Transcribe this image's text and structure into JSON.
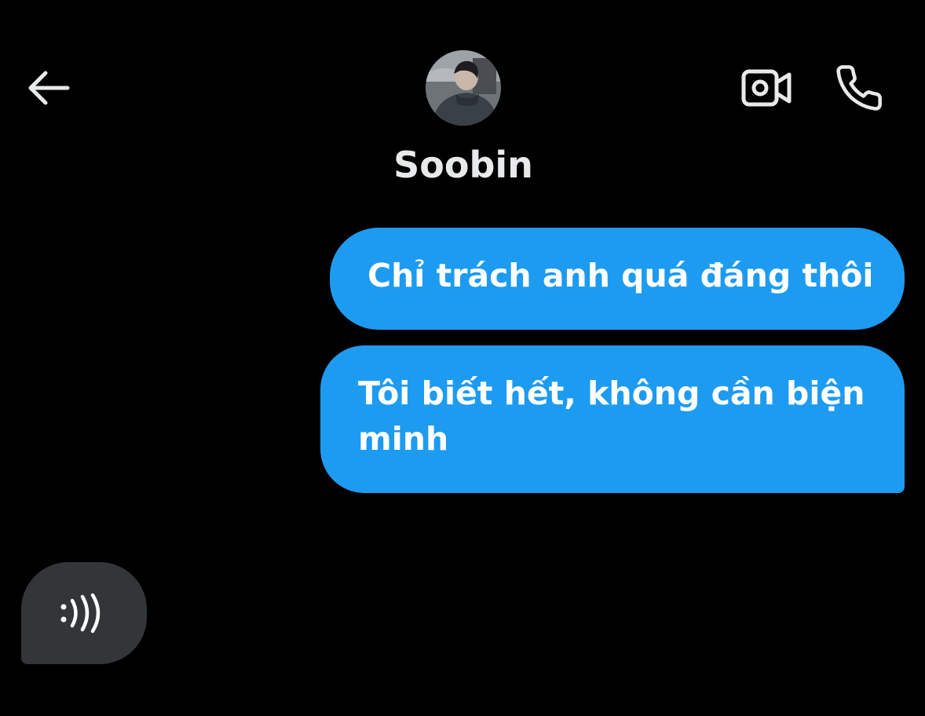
{
  "header": {
    "contact_name": "Soobin",
    "back_icon": "arrow-left-icon",
    "video_icon": "video-camera-icon",
    "call_icon": "phone-icon"
  },
  "messages": [
    {
      "sender": "me",
      "text": "Chỉ trách anh quá đáng thôi"
    },
    {
      "sender": "me",
      "text": "Tôi biết hết, không cần biện minh"
    }
  ],
  "typing_indicator": {
    "icon": "sound-wave-icon"
  },
  "colors": {
    "background": "#000000",
    "sent_bubble": "#1d9bf0",
    "typing_bubble": "#333639",
    "text_primary": "#e7e9ea"
  }
}
